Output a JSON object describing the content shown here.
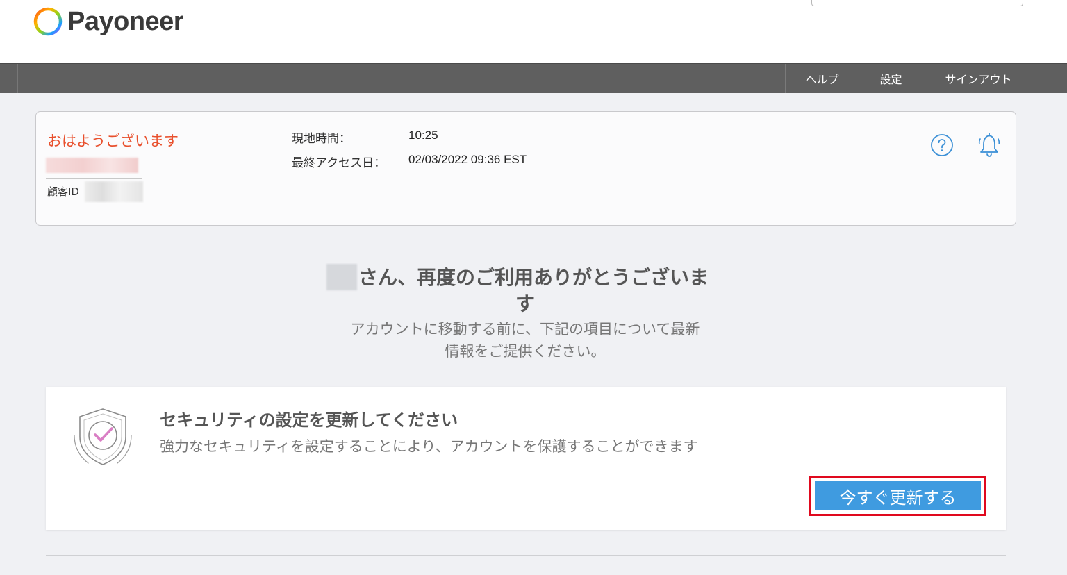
{
  "header": {
    "brand_name": "Payoneer",
    "logo_icon": "ring-logo-icon"
  },
  "nav": {
    "items": [
      {
        "label": "ヘルプ"
      },
      {
        "label": "設定"
      },
      {
        "label": "サインアウト"
      }
    ]
  },
  "account_card": {
    "greeting": "おはようございます",
    "customer_id_label": "顧客ID",
    "local_time_label": "現地時間：",
    "local_time_value": "10:25",
    "last_access_label": "最終アクセス日：",
    "last_access_value": "02/03/2022 09:36 EST",
    "help_icon": "question-circle-icon",
    "notification_icon": "bell-icon"
  },
  "welcome": {
    "title_line1": "さん、再度のご利用ありがとうございま",
    "title_line2": "す",
    "subtitle_line1": "アカウントに移動する前に、下記の項目について最新",
    "subtitle_line2": "情報をご提供ください。"
  },
  "security_card": {
    "icon": "shield-check-icon",
    "title": "セキュリティの設定を更新してください",
    "description": "強力なセキュリティを設定することにより、アカウントを保護することができます",
    "button_label": "今すぐ更新する"
  },
  "colors": {
    "accent_orange": "#e8502d",
    "button_blue": "#3f9be0",
    "highlight_red": "#e0091e",
    "navbar_gray": "#5f5f5f",
    "icon_blue": "#3a8fd6"
  }
}
